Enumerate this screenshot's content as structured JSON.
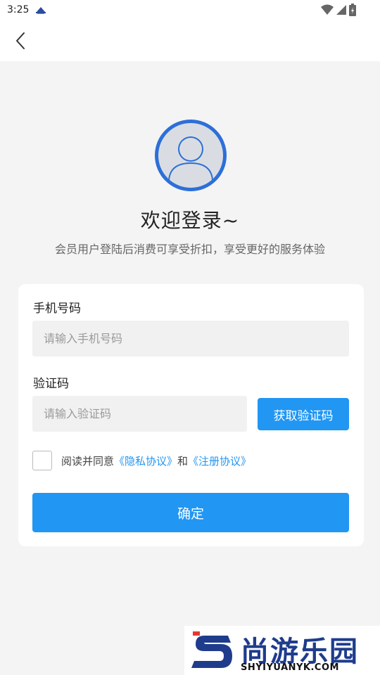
{
  "status_bar": {
    "time": "3:25"
  },
  "welcome": {
    "title": "欢迎登录~",
    "subtitle": "会员用户登陆后消费可享受折扣，享受更好的服务体验"
  },
  "form": {
    "phone_label": "手机号码",
    "phone_placeholder": "请输入手机号码",
    "phone_value": "",
    "code_label": "验证码",
    "code_placeholder": "请输入验证码",
    "code_value": "",
    "get_code_button": "获取验证码",
    "agree_prefix": "阅读并同意",
    "privacy_link": "《隐私协议》",
    "agree_and": "和",
    "register_link": "《注册协议》",
    "agreed": false,
    "confirm_button": "确定"
  },
  "watermark": {
    "name": "尚游乐园",
    "url": "SHYIYUANYK.COM"
  },
  "colors": {
    "accent": "#2196f3",
    "avatar_bg": "#2d6fd8",
    "page_bg": "#f4f4f4",
    "input_bg": "#f1f1f1"
  },
  "icons": [
    "back-icon",
    "avatar-icon",
    "wifi-icon",
    "signal-icon",
    "battery-icon"
  ]
}
